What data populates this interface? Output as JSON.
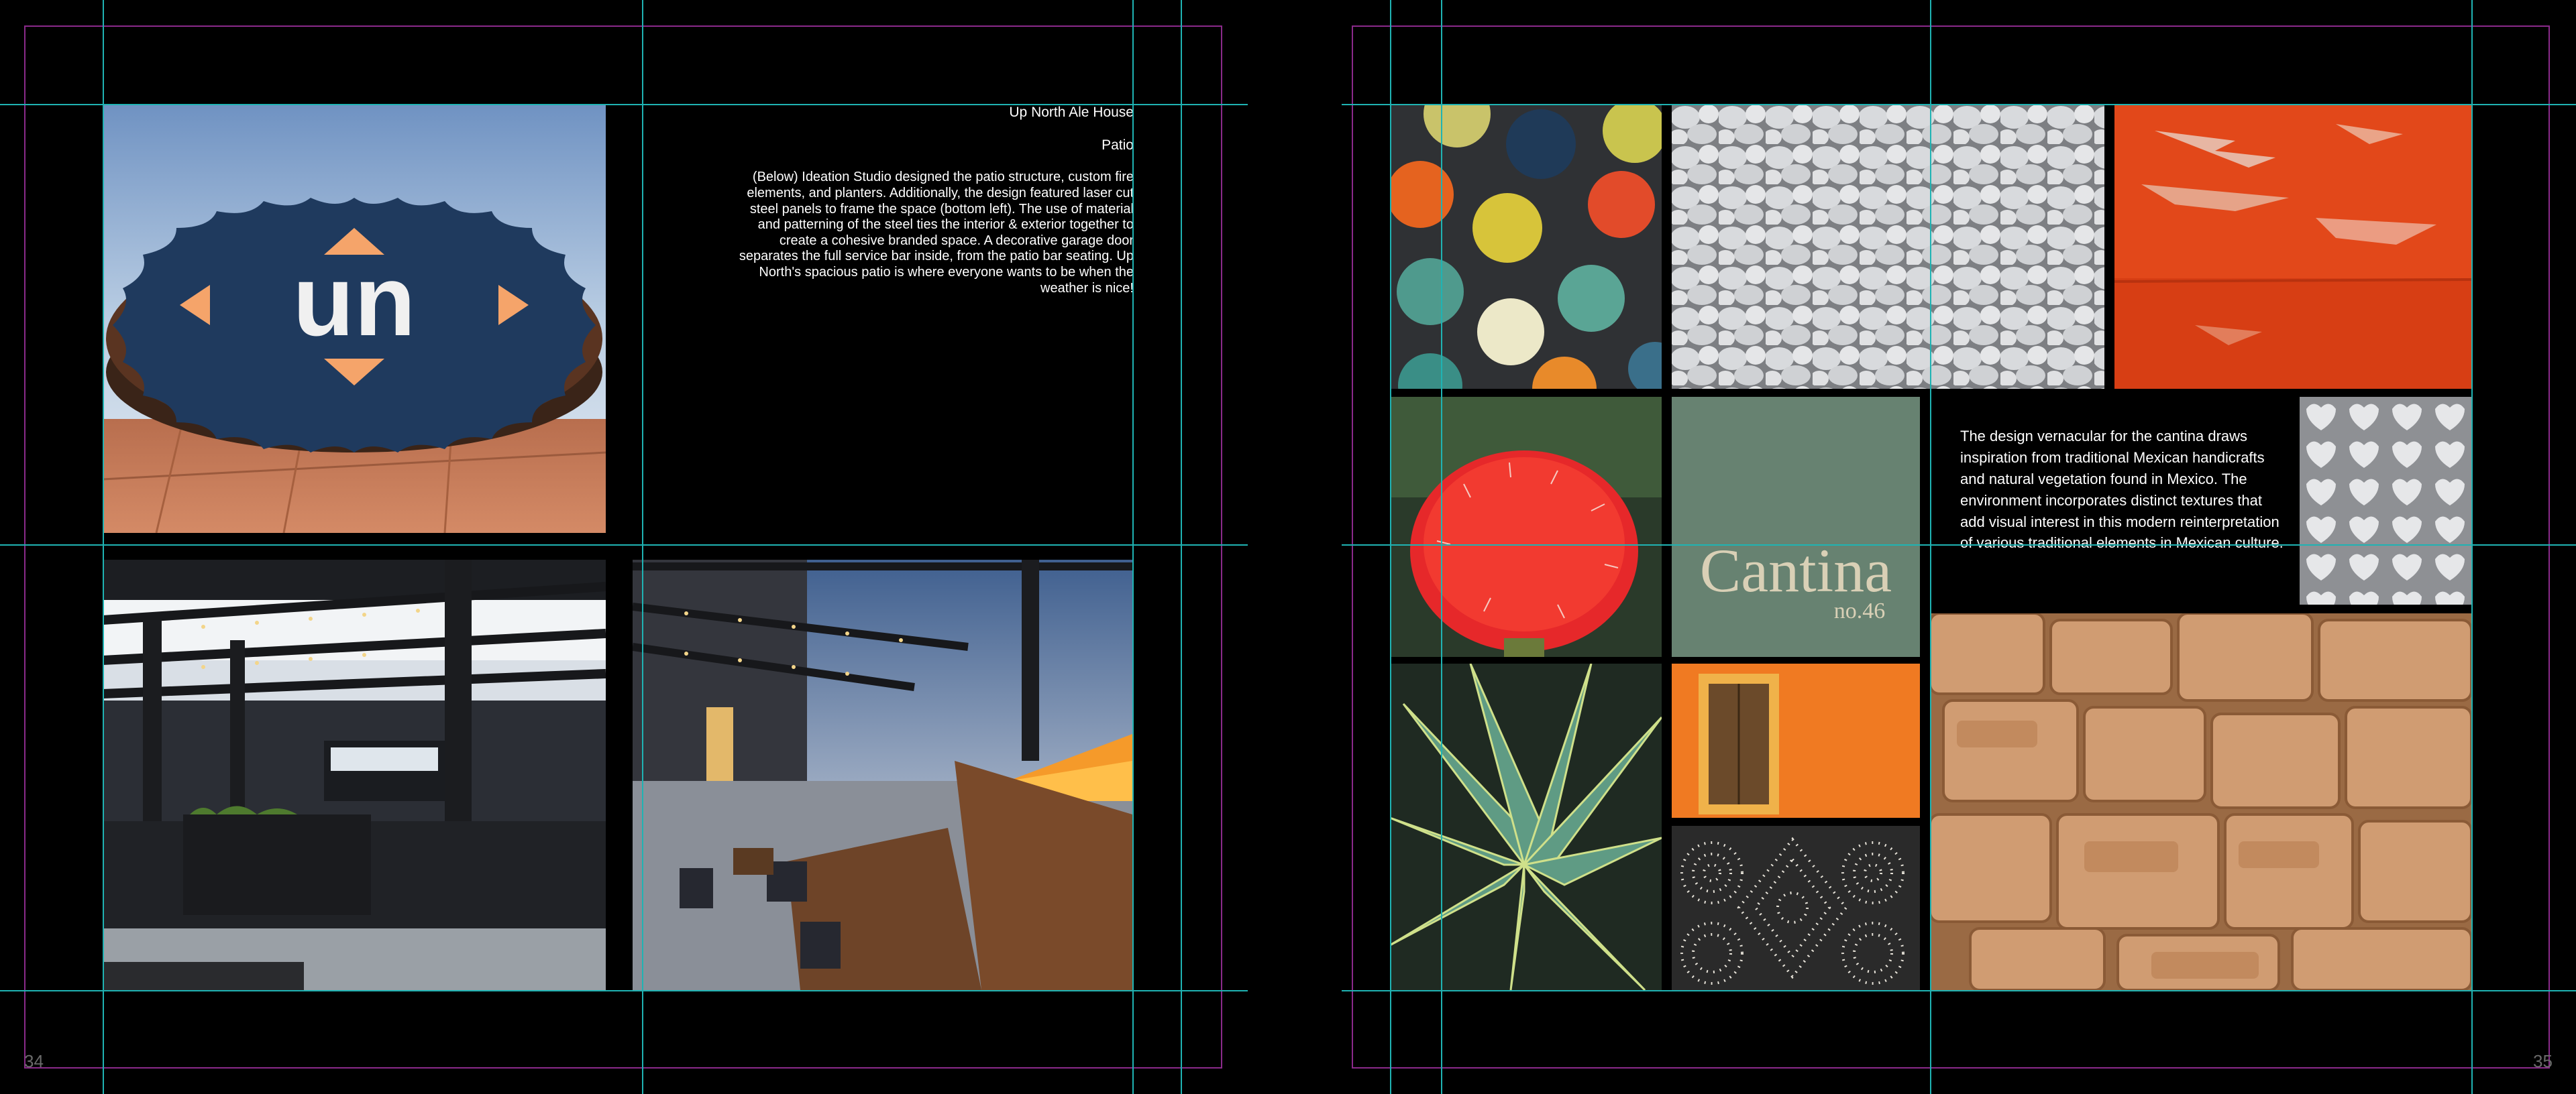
{
  "spread": {
    "left_page": {
      "title": "Up North Ale House",
      "subtitle": "Patio",
      "body": "(Below) Ideation Studio designed the patio structure, custom fire elements, and planters. Additionally, the design featured laser cut steel panels to frame the space (bottom left). The use of material and patterning of the steel ties the interior & exterior together to create a cohesive branded space. A decorative garage door separates the full service bar inside, from the patio bar seating. Up North's spacious patio is where everyone wants to be when the weather is nice!",
      "page_number": "34",
      "logo_text": "un"
    },
    "right_page": {
      "body": "The design vernacular for the cantina draws inspiration from traditional Mexican handicrafts and natural vegetation found in Mexico. The environment incorporates distinct textures that add visual interest in this modern reinterpretation of various traditional elements in Mexican culture.",
      "sign_word": "Cantina",
      "sign_sub": "no.46",
      "page_number": "35"
    }
  },
  "colors": {
    "background": "#000000",
    "guide": "#1fb3b3",
    "margin": "#8a2a8a",
    "accent_orange": "#f26b2a",
    "leather": "#c8946a"
  }
}
